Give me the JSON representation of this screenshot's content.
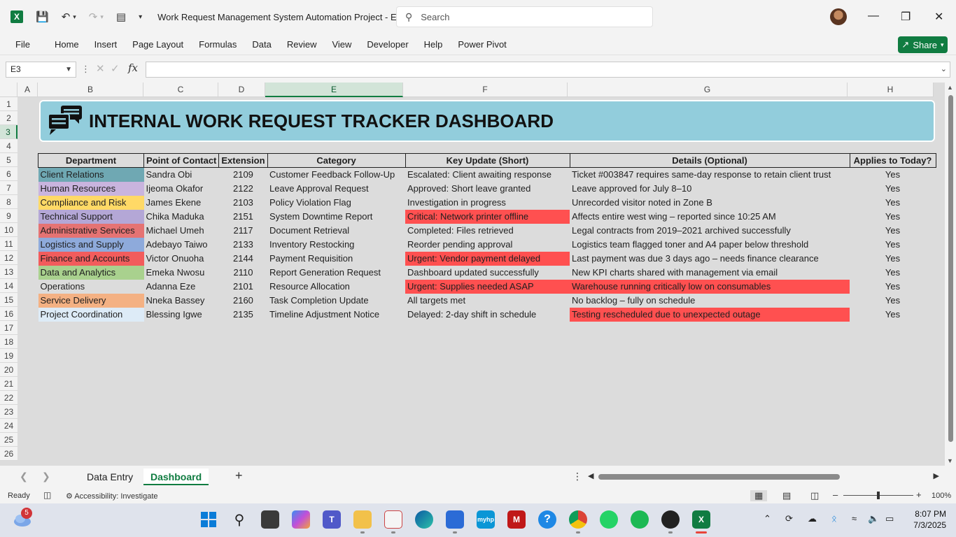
{
  "window": {
    "title": "Work Request Management System Automation Project  -  E...",
    "search_placeholder": "Search"
  },
  "ribbon": {
    "tabs": [
      "File",
      "Home",
      "Insert",
      "Page Layout",
      "Formulas",
      "Data",
      "Review",
      "View",
      "Developer",
      "Help",
      "Power Pivot"
    ],
    "share_label": "Share"
  },
  "formula_bar": {
    "name_box": "E3",
    "fx_label": "fx",
    "value": ""
  },
  "grid": {
    "columns": [
      "A",
      "B",
      "C",
      "D",
      "E",
      "F",
      "G",
      "H"
    ],
    "selected_column": "E",
    "rows": [
      "1",
      "2",
      "3",
      "4",
      "5",
      "6",
      "7",
      "8",
      "9",
      "10",
      "11",
      "12",
      "13",
      "14",
      "15",
      "16",
      "17",
      "18",
      "19",
      "20",
      "21",
      "22",
      "23",
      "24",
      "25",
      "26"
    ],
    "selected_row": "3"
  },
  "dashboard": {
    "title": "INTERNAL WORK REQUEST TRACKER DASHBOARD",
    "headers": [
      "Department",
      "Point of Contact",
      "Extension",
      "Category",
      "Key Update (Short)",
      "Details (Optional)",
      "Applies to Today?"
    ],
    "rows": [
      {
        "department": "Client Relations",
        "dept_color": "#6fa8b3",
        "contact": "Sandra Obi",
        "extension": "2109",
        "category": "Customer Feedback Follow-Up",
        "update": "Escalated: Client awaiting response",
        "update_alert": false,
        "details": "Ticket #003847 requires same-day response to retain client trust",
        "details_alert": false,
        "today": "Yes"
      },
      {
        "department": "Human Resources",
        "dept_color": "#c9b4de",
        "contact": "Ijeoma Okafor",
        "extension": "2122",
        "category": "Leave Approval Request",
        "update": "Approved: Short leave granted",
        "update_alert": false,
        "details": "Leave approved for July 8–10",
        "details_alert": false,
        "today": "Yes"
      },
      {
        "department": "Compliance and Risk",
        "dept_color": "#ffd966",
        "contact": "James Ekene",
        "extension": "2103",
        "category": "Policy Violation Flag",
        "update": "Investigation in progress",
        "update_alert": false,
        "details": "Unrecorded visitor noted in Zone B",
        "details_alert": false,
        "today": "Yes"
      },
      {
        "department": "Technical Support",
        "dept_color": "#b4a7d6",
        "contact": "Chika Maduka",
        "extension": "2151",
        "category": "System Downtime Report",
        "update": "Critical: Network printer offline",
        "update_alert": true,
        "details": "Affects entire west wing – reported since 10:25 AM",
        "details_alert": false,
        "today": "Yes"
      },
      {
        "department": "Administrative Services",
        "dept_color": "#e57373",
        "contact": "Michael Umeh",
        "extension": "2117",
        "category": "Document Retrieval",
        "update": "Completed: Files retrieved",
        "update_alert": false,
        "details": "Legal contracts from 2019–2021 archived successfully",
        "details_alert": false,
        "today": "Yes"
      },
      {
        "department": "Logistics and Supply",
        "dept_color": "#8eaadb",
        "contact": "Adebayo Taiwo",
        "extension": "2133",
        "category": "Inventory Restocking",
        "update": "Reorder pending approval",
        "update_alert": false,
        "details": "Logistics team flagged toner and A4 paper below threshold",
        "details_alert": false,
        "today": "Yes"
      },
      {
        "department": "Finance and Accounts",
        "dept_color": "#f25c5c",
        "contact": "Victor Onuoha",
        "extension": "2144",
        "category": "Payment Requisition",
        "update": "Urgent: Vendor payment delayed",
        "update_alert": true,
        "details": "Last payment was due 3 days ago – needs finance clearance",
        "details_alert": false,
        "today": "Yes"
      },
      {
        "department": "Data and Analytics",
        "dept_color": "#a9d18e",
        "contact": "Emeka Nwosu",
        "extension": "2110",
        "category": "Report Generation Request",
        "update": "Dashboard updated successfully",
        "update_alert": false,
        "details": "New KPI charts shared with management via email",
        "details_alert": false,
        "today": "Yes"
      },
      {
        "department": "Operations",
        "dept_color": "",
        "contact": "Adanna Eze",
        "extension": "2101",
        "category": "Resource Allocation",
        "update": "Urgent: Supplies needed ASAP",
        "update_alert": true,
        "details": "Warehouse running critically low on consumables",
        "details_alert": true,
        "today": "Yes"
      },
      {
        "department": "Service Delivery",
        "dept_color": "#f4b183",
        "contact": "Nneka Bassey",
        "extension": "2160",
        "category": "Task Completion Update",
        "update": "All targets met",
        "update_alert": false,
        "details": "No backlog – fully on schedule",
        "details_alert": false,
        "today": "Yes"
      },
      {
        "department": "Project Coordination",
        "dept_color": "#ddebf7",
        "contact": "Blessing Igwe",
        "extension": "2135",
        "category": "Timeline Adjustment Notice",
        "update": "Delayed: 2-day shift in schedule",
        "update_alert": false,
        "details": "Testing rescheduled due to unexpected outage",
        "details_alert": true,
        "today": "Yes"
      }
    ]
  },
  "sheets": {
    "tabs": [
      "Data Entry",
      "Dashboard"
    ],
    "active": "Dashboard"
  },
  "status": {
    "ready": "Ready",
    "accessibility": "Accessibility: Investigate",
    "zoom": "100%"
  },
  "taskbar": {
    "weather_badge": "5",
    "time": "8:07 PM",
    "date": "7/3/2025"
  },
  "colors": {
    "excel_green": "#107c41",
    "banner": "#92cddc",
    "alert_red": "#ff5050"
  }
}
